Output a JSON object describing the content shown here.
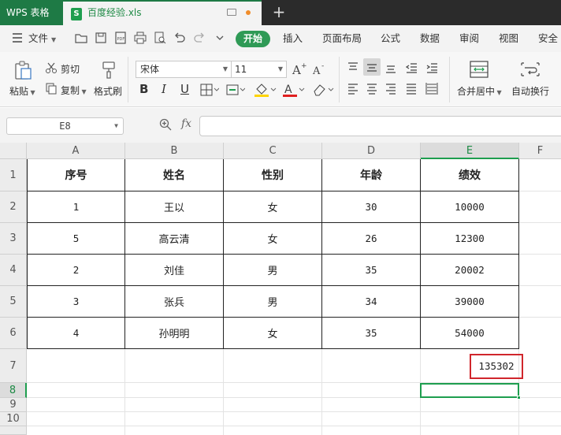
{
  "titlebar": {
    "app_name": "WPS 表格",
    "doc_icon_letter": "S",
    "doc_name": "百度经验.xls",
    "new_tab": "+"
  },
  "menubar": {
    "file_label": "文件",
    "tabs": [
      "开始",
      "插入",
      "页面布局",
      "公式",
      "数据",
      "审阅",
      "视图",
      "安全"
    ]
  },
  "ribbon": {
    "paste": "粘贴",
    "cut": "剪切",
    "copy": "复制",
    "format_painter": "格式刷",
    "font_name": "宋体",
    "font_size": "11",
    "bold": "B",
    "italic": "I",
    "underline": "U",
    "merge_center": "合并居中",
    "wrap_text": "自动换行"
  },
  "formula_bar": {
    "cell_ref": "E8",
    "fx": "fx",
    "value": ""
  },
  "sheet": {
    "columns": [
      "A",
      "B",
      "C",
      "D",
      "E",
      "F"
    ],
    "rows": [
      "1",
      "2",
      "3",
      "4",
      "5",
      "6",
      "7",
      "8",
      "9",
      "10"
    ],
    "active_column": "E",
    "active_row": "8",
    "header": [
      "序号",
      "姓名",
      "性别",
      "年龄",
      "绩效"
    ],
    "data": [
      [
        "1",
        "王以",
        "女",
        "30",
        "10000"
      ],
      [
        "5",
        "高云清",
        "女",
        "26",
        "12300"
      ],
      [
        "2",
        "刘佳",
        "男",
        "35",
        "20002"
      ],
      [
        "3",
        "张兵",
        "男",
        "34",
        "39000"
      ],
      [
        "4",
        "孙明明",
        "女",
        "35",
        "54000"
      ]
    ],
    "sum_value": "135302"
  },
  "colors": {
    "accent": "#1e9e4f",
    "app_tab": "#1e7a45",
    "start_tab": "#2f9a56",
    "highlight_border": "#d0262c"
  }
}
